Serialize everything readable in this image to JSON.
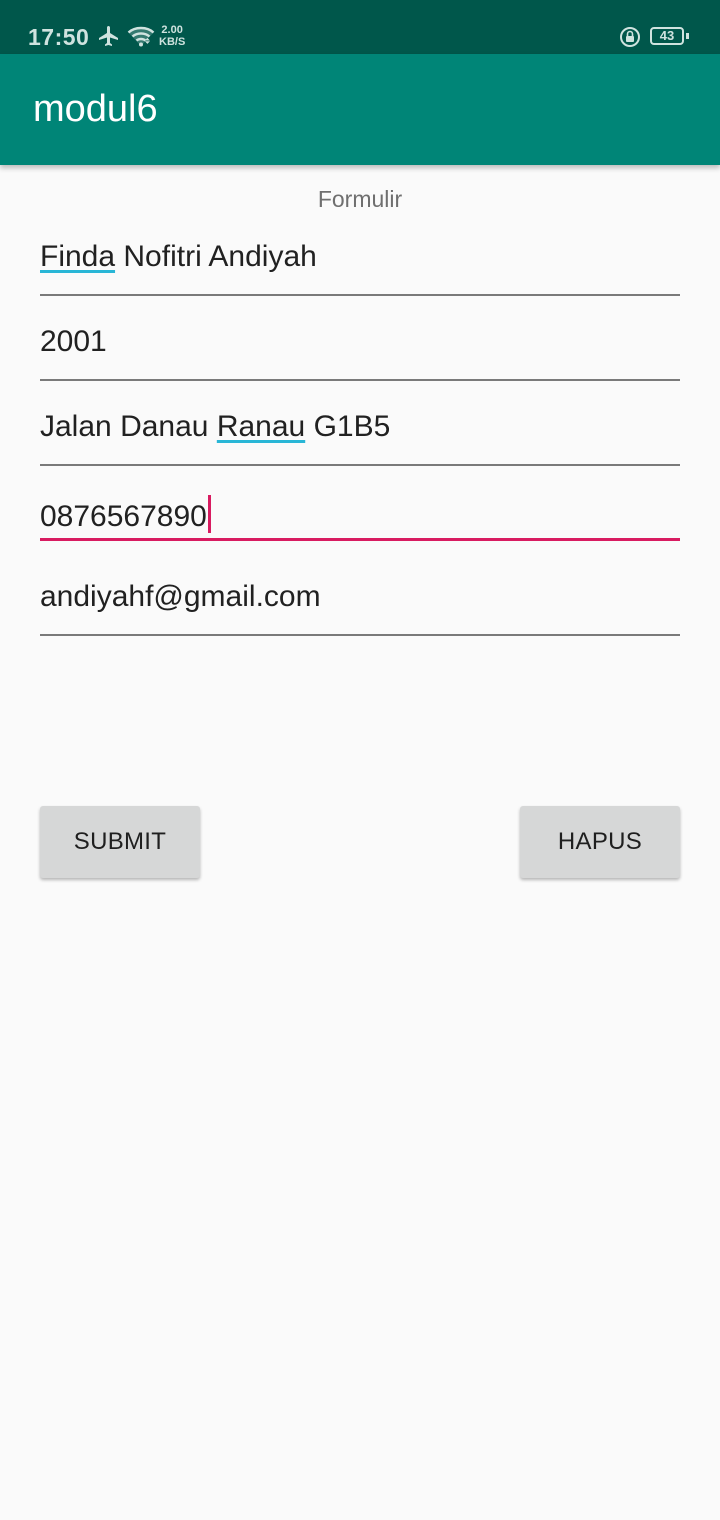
{
  "status_bar": {
    "time": "17:50",
    "net_speed_value": "2.00",
    "net_speed_unit": "KB/S",
    "battery": "43",
    "icons": [
      "airplane-icon",
      "wifi-icon",
      "lock-rotation-icon",
      "battery-icon"
    ]
  },
  "app_bar": {
    "title": "modul6"
  },
  "form": {
    "title": "Formulir",
    "fields": [
      {
        "value": "Finda Nofitri Andiyah"
      },
      {
        "value": "2001"
      },
      {
        "value": "Jalan Danau Ranau G1B5"
      },
      {
        "value": "0876567890",
        "focused": true
      },
      {
        "value": "andiyahf@gmail.com"
      }
    ]
  },
  "buttons": {
    "submit": "SUBMIT",
    "hapus": "HAPUS"
  },
  "colors": {
    "status_bar": "#00574b",
    "app_bar": "#008577",
    "accent": "#d81b60",
    "spellcheck": "#29b6d6",
    "button": "#d6d7d7"
  }
}
